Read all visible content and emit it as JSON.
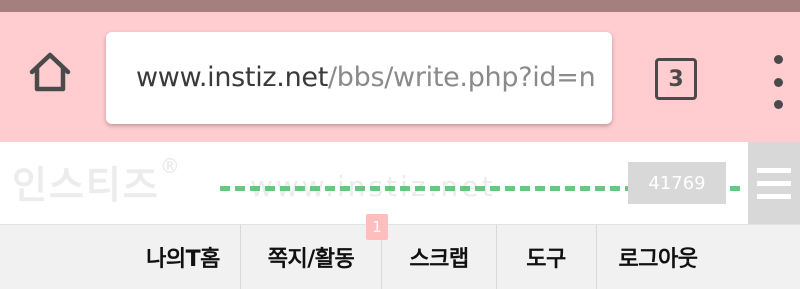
{
  "browser": {
    "url_host": "www.instiz.net",
    "url_path": "/bbs/write.php?id=na",
    "tab_count": "3",
    "icons": {
      "home": "home-icon",
      "tabs": "tabs-counter-icon",
      "menu": "overflow-menu-icon"
    },
    "colors": {
      "toolbar_bg": "#ffcccf",
      "status_strip": "#a47f7d",
      "icon": "#4a4a4a"
    }
  },
  "site": {
    "logo_text": "인스티즈",
    "logo_mark": "®",
    "banner_watermark": "www.instiz.net",
    "counter": "41769",
    "icons": {
      "menu": "hamburger-icon"
    },
    "colors": {
      "banner_line": "#4fbf6a",
      "counter_bg": "#d8d8d8"
    }
  },
  "nav": {
    "items": [
      {
        "label": "나의T홈"
      },
      {
        "label": "쪽지/활동"
      },
      {
        "label": "스크랩"
      },
      {
        "label": "도구"
      },
      {
        "label": "로그아웃"
      }
    ],
    "notification_count": "1",
    "colors": {
      "bg": "#f1f1f1",
      "badge": "#ffbdbd"
    }
  }
}
